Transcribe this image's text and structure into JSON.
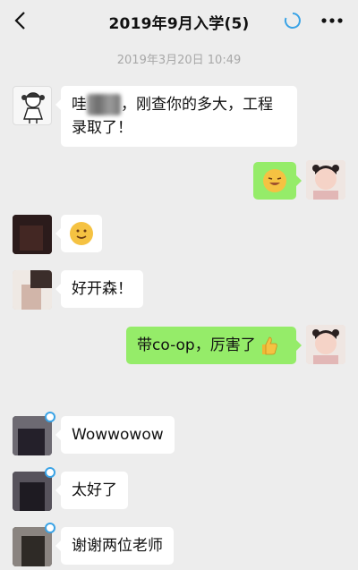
{
  "nav": {
    "title": "2019年9月入学(5)",
    "back_icon": "chevron-left-icon",
    "sync_icon": "sync-circle-icon",
    "more_icon": "more-dots-icon"
  },
  "timestamp": "2019年3月20日 10:49",
  "messages": [
    {
      "side": "in",
      "parts": [
        "哇",
        "，刚查你的多大，工程",
        "录取了！"
      ]
    },
    {
      "side": "out",
      "emoji": "laughing-emoji"
    },
    {
      "side": "in",
      "emoji": "hug-emoji"
    },
    {
      "side": "in",
      "text": "好开森！"
    },
    {
      "side": "out",
      "text": "带co-op，厉害了",
      "emoji": "thumbs-up-emoji"
    },
    {
      "side": "in",
      "text": "Wowwowow"
    },
    {
      "side": "in",
      "text": "太好了"
    },
    {
      "side": "in",
      "text": "谢谢两位老师"
    }
  ],
  "colors": {
    "background": "#ededed",
    "incoming_bubble": "#ffffff",
    "outgoing_bubble": "#95ec69",
    "accent": "#3aa3e6"
  }
}
